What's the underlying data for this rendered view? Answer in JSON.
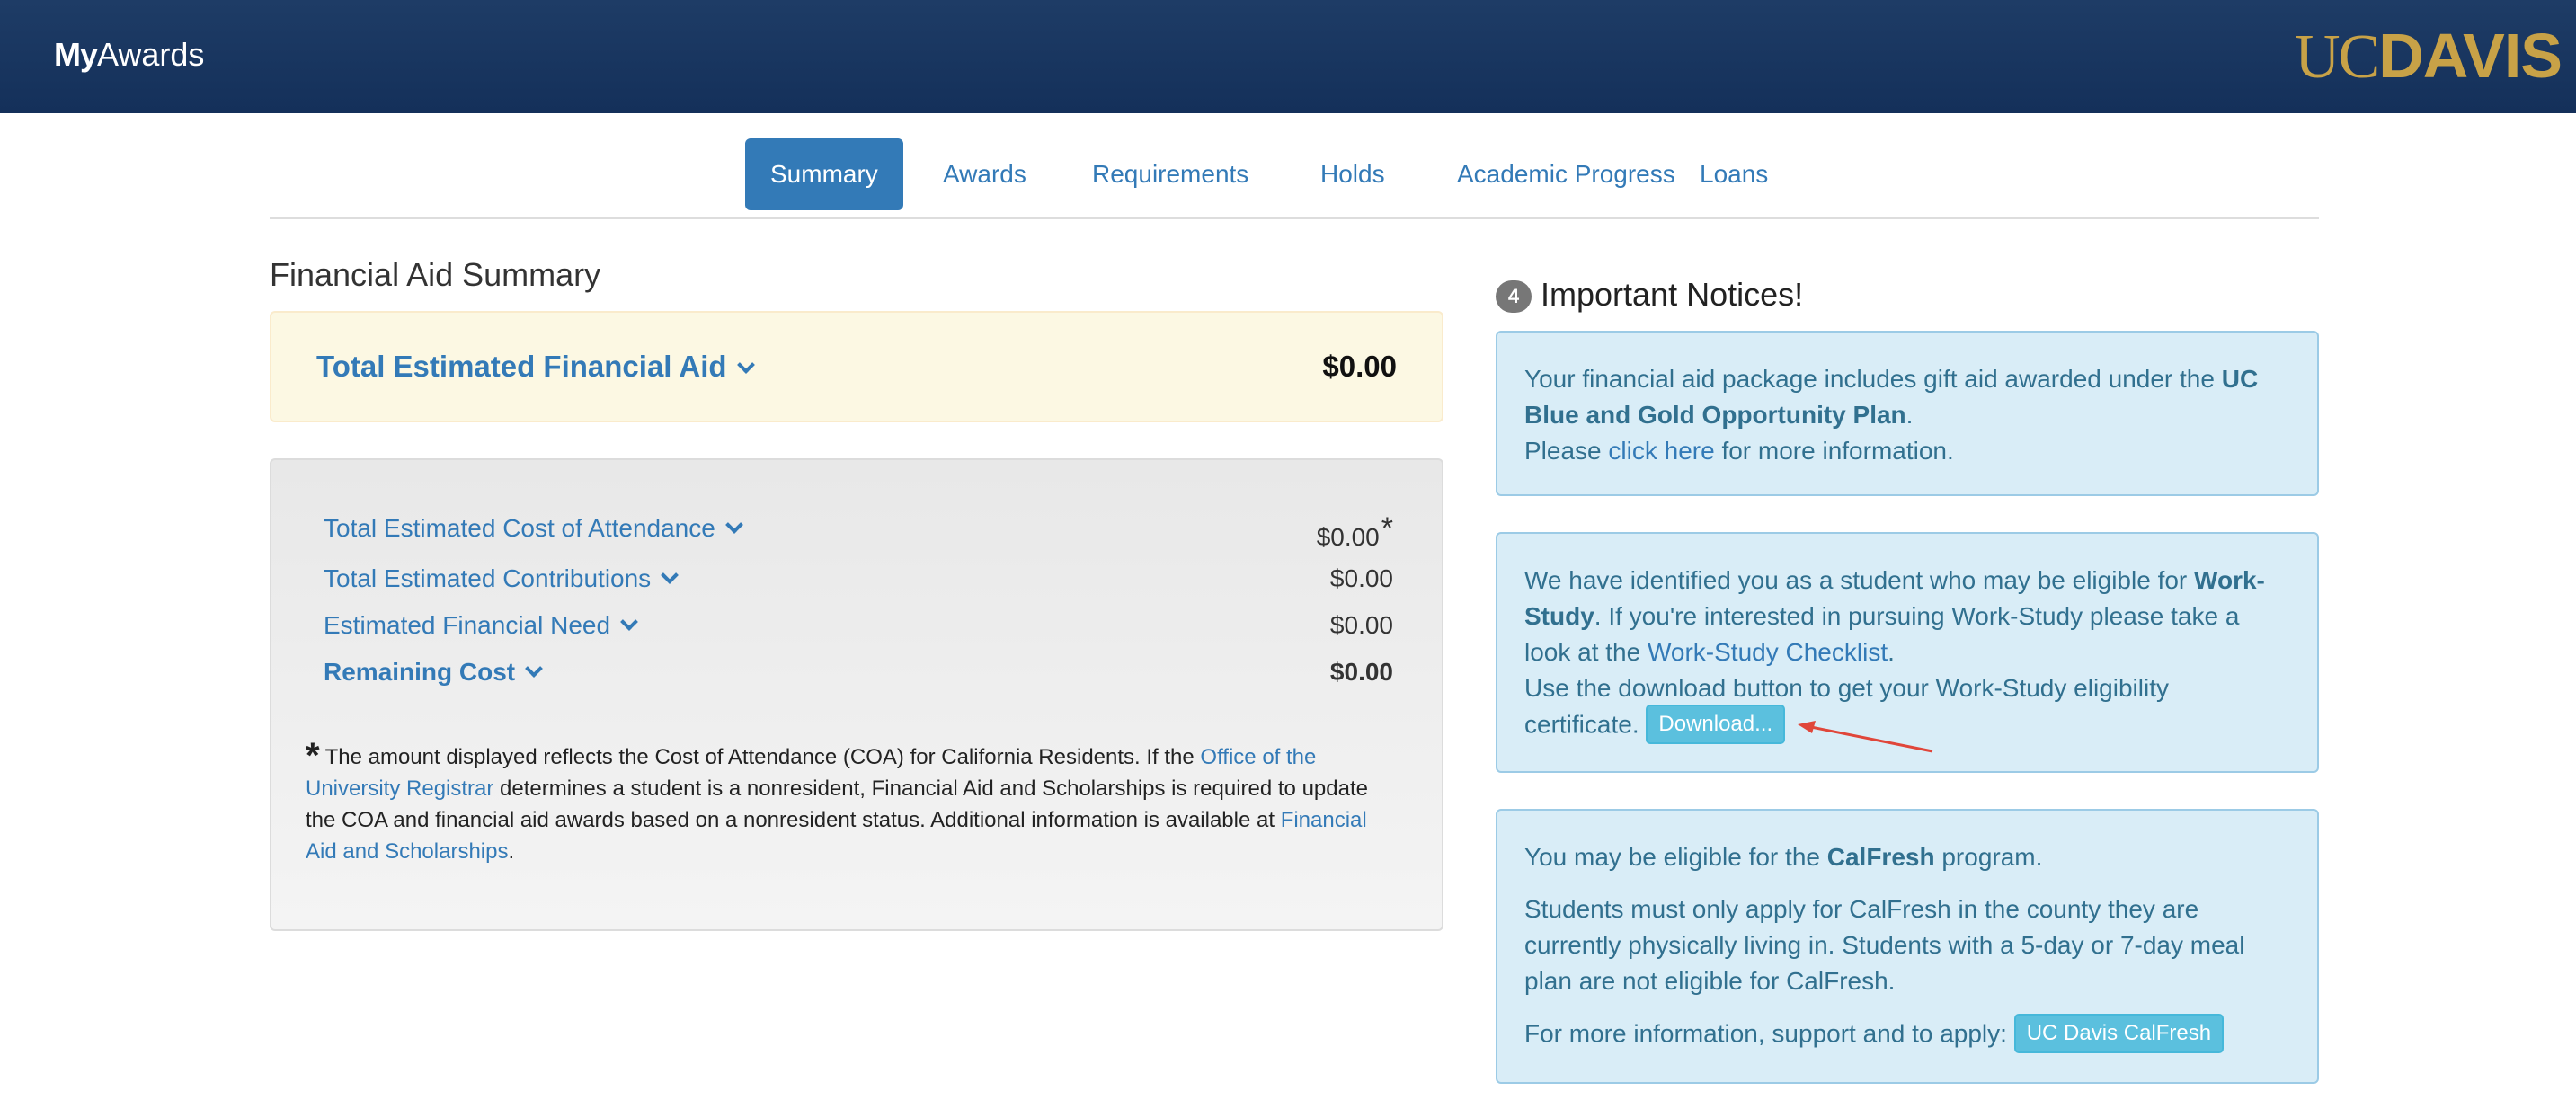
{
  "header": {
    "brand_bold": "My",
    "brand_rest": "Awards",
    "logo_uc": "UC",
    "logo_davis": "DAVIS"
  },
  "tabs": [
    {
      "label": "Summary",
      "active": true
    },
    {
      "label": "Awards"
    },
    {
      "label": "Requirements"
    },
    {
      "label": "Holds"
    },
    {
      "label": "Academic Progress"
    },
    {
      "label": "Loans"
    }
  ],
  "summary": {
    "title": "Financial Aid Summary",
    "total_aid": {
      "label": "Total Estimated Financial Aid",
      "value": "$0.00"
    },
    "rows": [
      {
        "label": "Total Estimated Cost of Attendance",
        "value": "$0.00",
        "marker": "*"
      },
      {
        "label": "Total Estimated Contributions",
        "value": "$0.00"
      },
      {
        "label": "Estimated Financial Need",
        "value": "$0.00"
      },
      {
        "label": "Remaining Cost",
        "value": "$0.00"
      }
    ],
    "footnote": {
      "star": "*",
      "text1": "The amount displayed reflects the Cost of Attendance (COA) for California Residents. If the ",
      "link1": "Office of the University Registrar",
      "text2": " determines a student is a nonresident, Financial Aid and Scholarships is required to update the COA and financial aid awards based on a nonresident status. Additional information is available at ",
      "link2": "Financial Aid and Scholarships",
      "text3": "."
    }
  },
  "notices": {
    "count": "4",
    "title": "Important Notices!",
    "blue_gold": {
      "text1": "Your financial aid package includes gift aid awarded under the ",
      "bold": "UC Blue and Gold Opportunity Plan",
      "text2": ".",
      "text3": "Please ",
      "link": "click here",
      "text4": " for more information."
    },
    "work_study": {
      "text1": "We have identified you as a student who may be eligible for ",
      "bold": "Work-Study",
      "text2": ". If you're interested in pursuing Work-Study please take a look at the ",
      "link": "Work-Study Checklist",
      "text3": ".",
      "text4": "Use the download button to get your Work-Study eligibility certificate. ",
      "button": "Download..."
    },
    "calfresh": {
      "text1": "You may be eligible for the ",
      "bold": "CalFresh",
      "text2": " program.",
      "para2": "Students must only apply for CalFresh in the county they are currently physically living in. Students with a 5-day or 7-day meal plan are not eligible for CalFresh.",
      "text3": "For more information, support and to apply: ",
      "button": "UC Davis CalFresh"
    }
  },
  "colors": {
    "header_bg": "#1e3c66",
    "accent": "#337ab7",
    "logo_gold": "#c8a247",
    "notice_bg": "#d9edf7",
    "notice_text": "#31708f",
    "warning_bg": "#fcf8e3",
    "annotation_arrow": "#e0463a"
  }
}
